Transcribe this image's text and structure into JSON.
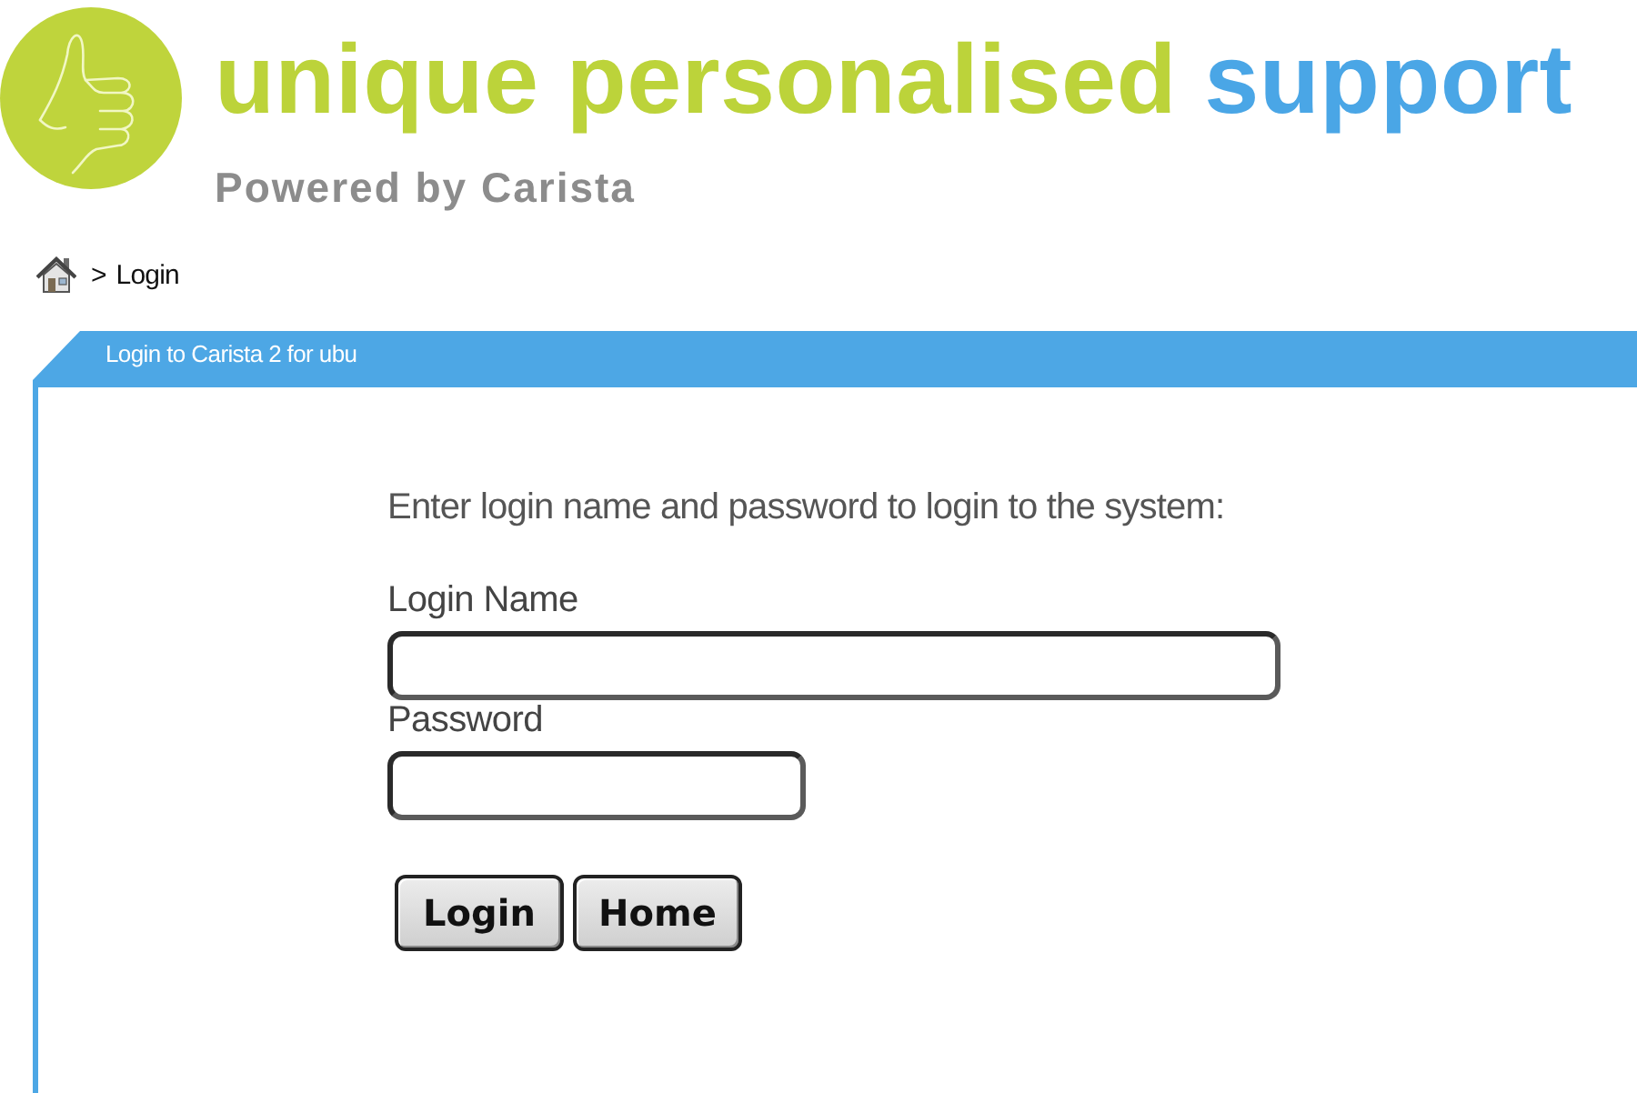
{
  "logo": {
    "slogan": "unique personalised",
    "slogan_highlight": "support",
    "subtitle": "Powered by Carista"
  },
  "breadcrumb": {
    "separator": ">",
    "items": [
      "Login"
    ]
  },
  "panel": {
    "title": "Login to Carista 2 for ubu",
    "instructions": "Enter login name and password to login to the system:",
    "fields": [
      {
        "label": "Login Name",
        "kind": "text"
      },
      {
        "label": "Password",
        "kind": "password"
      }
    ],
    "buttons": [
      "Login",
      "Home"
    ]
  }
}
